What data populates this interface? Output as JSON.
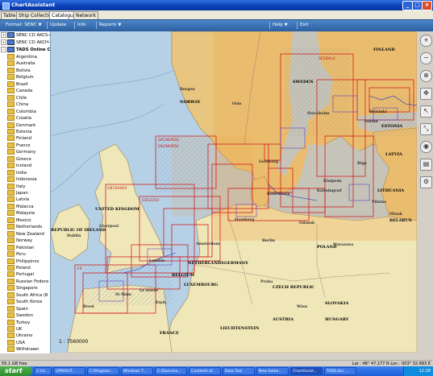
{
  "window": {
    "title": "ChartAssistant"
  },
  "tabs": [
    {
      "label": "Table"
    },
    {
      "label": "Ship Collection"
    },
    {
      "label": "Catalogue"
    },
    {
      "label": "Network"
    }
  ],
  "toolbar": {
    "format_label": "Format: SENC",
    "update_label": "Update",
    "info_label": "Info",
    "reports_label": "Reports",
    "help_label": "Help",
    "exit_label": "Exit"
  },
  "tree": {
    "top": [
      {
        "label": "SENC CD AKCS-00"
      },
      {
        "label": "SENC CD AKCH-11"
      },
      {
        "label": "TADS Online Cat"
      }
    ],
    "countries": [
      "Argentina",
      "Australia",
      "Bolivia",
      "Belgium",
      "Brazil",
      "Canada",
      "Chile",
      "China",
      "Colombia",
      "Croatia",
      "Denmark",
      "Estonia",
      "Finland",
      "France",
      "Germany",
      "Greece",
      "Iceland",
      "India",
      "Indonesia",
      "Italy",
      "Japan",
      "Latvia",
      "Malacca",
      "Malaysia",
      "Mexico",
      "Netherlands",
      "New Zealand",
      "Norway",
      "Pakistan",
      "Peru",
      "Philippines",
      "Poland",
      "Portugal",
      "Russian Federa",
      "Singapore",
      "South Africa (R",
      "South Korea",
      "Spain",
      "Sweden",
      "Turkey",
      "UK",
      "Ukraine",
      "USA",
      "Withdrawn"
    ]
  },
  "map": {
    "scale_label": "1 : 7560000",
    "countries": [
      "NORWAY",
      "SWEDEN",
      "FINLAND",
      "ESTONIA",
      "LATVIA",
      "LITHUANIA",
      "BELARUS",
      "UNITED KINGDOM",
      "REPUBLIC OF IRELAND",
      "NETHERLANDS",
      "BELGIUM",
      "LUXEMBOURG",
      "GERMANY",
      "POLAND",
      "CZECH REPUBLIC",
      "SLOVAKIA",
      "AUSTRIA",
      "HUNGARY",
      "FRANCE",
      "LIECHTENSTEIN"
    ],
    "cities": [
      "Bergen",
      "Oslo",
      "Stockholm",
      "Helsinki",
      "Tallinn",
      "Riga",
      "Vilnius",
      "Minsk",
      "Gdansk",
      "Berlin",
      "Warszawa",
      "Hamburg",
      "Amsterdam",
      "London",
      "Dublin",
      "Liverpool",
      "Praha",
      "Wien",
      "Paris",
      "Klaipeda",
      "Kaliningrad",
      "Goteborg",
      "Kobenhavn",
      "St Malo",
      "Brest",
      "Le Havre"
    ],
    "cells": [
      "GB100004",
      "DK1NOR50",
      "DK2NOR50",
      "GB12203",
      "SE2BALS",
      "FR"
    ]
  },
  "right_tools": [
    "zoom-in",
    "zoom-out",
    "zoom-to-fit",
    "pan",
    "select",
    "measure",
    "compass",
    "layer",
    "settings"
  ],
  "status": {
    "left": "55.1 GB free",
    "right": "Lat : 48° 47.177 N Lon : 003° 32.683 E"
  },
  "taskbar": {
    "start": "start",
    "tasks": [
      "2 Int...",
      "\\\\PAYOUT...",
      "C:\\Program...",
      "Windows T...",
      "C:\\Docume...",
      "Contents of...",
      "Data Tool",
      "New folder...",
      "ChartAssist...",
      "TADS.doc ..."
    ],
    "clock": "12:28"
  }
}
